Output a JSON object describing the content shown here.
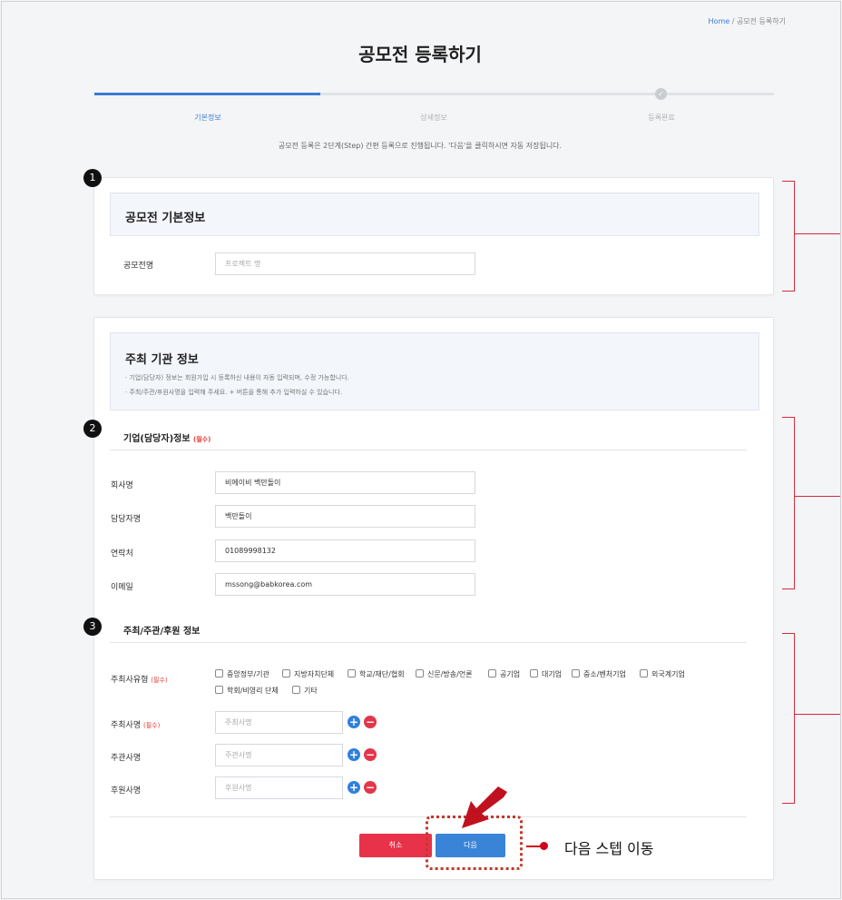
{
  "breadcrumb": {
    "home": "Home",
    "sep": " / ",
    "current": "공모전 등록하기"
  },
  "page_title": "공모전 등록하기",
  "steps": [
    {
      "label": "기본정보",
      "active": true
    },
    {
      "label": "상세정보",
      "active": false
    },
    {
      "label": "등록완료",
      "active": false
    }
  ],
  "step_done_icon": "✓",
  "notice": "공모전 등록은 2단계(Step) 간편 등록으로 진행됩니다. '다음'을 클릭하시면 자동 저장됩니다.",
  "section1": {
    "badge": "1",
    "title": "공모전 기본정보",
    "contest_name_label": "공모전명",
    "contest_name_placeholder": "프로젝트 명"
  },
  "section2": {
    "title": "주최 기관 정보",
    "desc1": "· 기업(담당자) 정보는 회원가입 시 등록하신 내용이 자동 입력되며, 수정 가능합니다.",
    "desc2": "· 주최/주관/후원사명을 입력해 주세요. + 버튼을 통해 추가 입력하실 수 있습니다.",
    "company_block": {
      "badge": "2",
      "title": "기업(담당자)정보",
      "required": "(필수)",
      "fields": [
        {
          "label": "회사명",
          "value": "비에이비 백만돌이"
        },
        {
          "label": "담당자명",
          "value": "백만돌이"
        },
        {
          "label": "연락처",
          "value": "01089998132"
        },
        {
          "label": "이메일",
          "value": "mssong@babkorea.com"
        }
      ]
    },
    "host_block": {
      "badge": "3",
      "title": "주최/주관/후원 정보",
      "type_label": "주최사유형",
      "type_required": "(필수)",
      "types": [
        "중앙정부/기관",
        "지방자치단체",
        "학교/재단/협회",
        "신문/방송/언론",
        "공기업",
        "대기업",
        "중소/벤처기업",
        "외국계기업",
        "학회/비영리 단체",
        "기타"
      ],
      "host_label": "주최사명",
      "host_required": "(필수)",
      "host_placeholder": "주최사명",
      "organizer_label": "주관사명",
      "organizer_placeholder": "주관사명",
      "sponsor_label": "후원사명",
      "sponsor_placeholder": "후원사명",
      "plus": "+",
      "minus": "−"
    }
  },
  "buttons": {
    "cancel": "취소",
    "next": "다음"
  },
  "annotation": {
    "callout": "다음 스텝 이동"
  },
  "colors": {
    "accent": "#3a84d8",
    "danger": "#e8324a",
    "annotation": "#d72a3c"
  }
}
